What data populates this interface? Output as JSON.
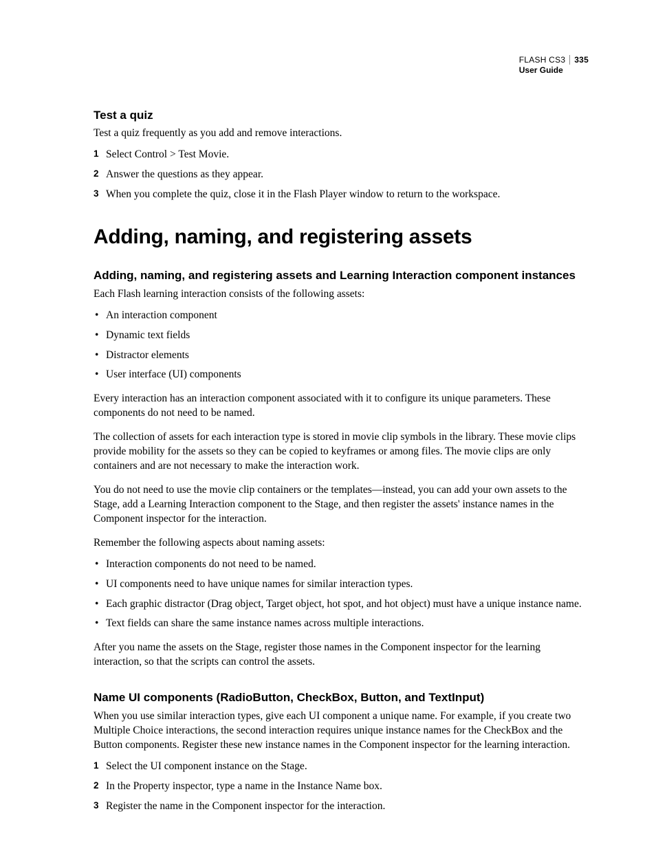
{
  "header": {
    "product": "FLASH CS3",
    "page_number": "335",
    "doc_title": "User Guide"
  },
  "section1": {
    "heading": "Test a quiz",
    "intro": "Test a quiz frequently as you add and remove interactions.",
    "steps": [
      "Select Control > Test Movie.",
      "Answer the questions as they appear.",
      "When you complete the quiz, close it in the Flash Player window to return to the workspace."
    ]
  },
  "chapter": {
    "title": "Adding, naming, and registering assets"
  },
  "section2": {
    "heading": "Adding, naming, and registering assets and Learning Interaction component instances",
    "intro": "Each Flash learning interaction consists of the following assets:",
    "bullets1": [
      "An interaction component",
      "Dynamic text fields",
      "Distractor elements",
      "User interface (UI) components"
    ],
    "para1": "Every interaction has an interaction component associated with it to configure its unique parameters. These components do not need to be named.",
    "para2": "The collection of assets for each interaction type is stored in movie clip symbols in the library. These movie clips provide mobility for the assets so they can be copied to keyframes or among files. The movie clips are only containers and are not necessary to make the interaction work.",
    "para3": "You do not need to use the movie clip containers or the templates—instead, you can add your own assets to the Stage, add a Learning Interaction component to the Stage, and then register the assets' instance names in the Component inspector for the interaction.",
    "para4": "Remember the following aspects about naming assets:",
    "bullets2": [
      "Interaction components do not need to be named.",
      "UI components need to have unique names for similar interaction types.",
      "Each graphic distractor (Drag object, Target object, hot spot, and hot object) must have a unique instance name.",
      "Text fields can share the same instance names across multiple interactions."
    ],
    "para5": "After you name the assets on the Stage, register those names in the Component inspector for the learning interaction, so that the scripts can control the assets."
  },
  "section3": {
    "heading": "Name UI components (RadioButton, CheckBox, Button, and TextInput)",
    "intro": "When you use similar interaction types, give each UI component a unique name. For example, if you create two Multiple Choice interactions, the second interaction requires unique instance names for the CheckBox and the Button components. Register these new instance names in the Component inspector for the learning interaction.",
    "steps": [
      "Select the UI component instance on the Stage.",
      "In the Property inspector, type a name in the Instance Name box.",
      "Register the name in the Component inspector for the interaction."
    ]
  }
}
